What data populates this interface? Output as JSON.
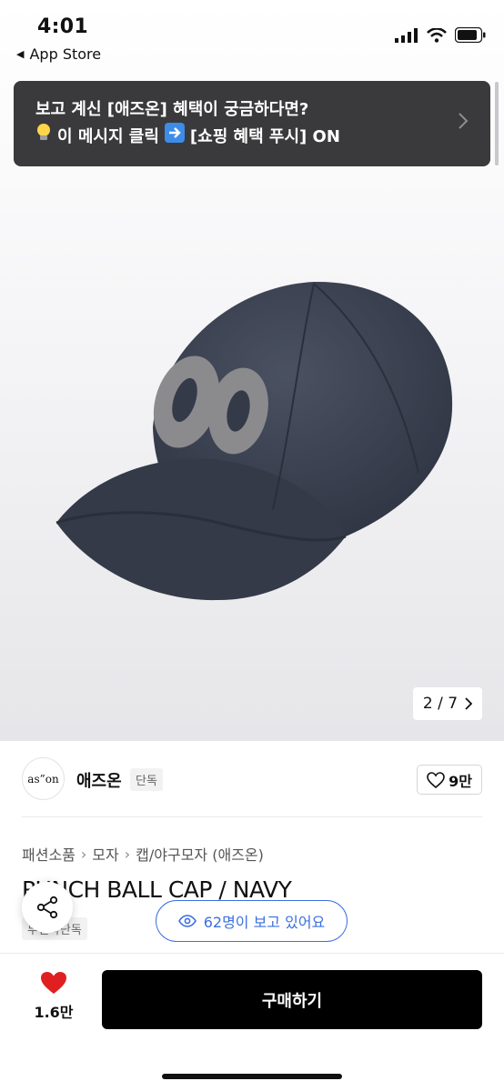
{
  "status_bar": {
    "time": "4:01",
    "back_app": "App Store"
  },
  "banner": {
    "line1": "보고 계신 [애즈온] 혜택이 궁금하다면?",
    "line2": "이 메시지 클릭",
    "line2_tail": "[쇼핑 혜택 푸시] ON",
    "icon1": "lightbulb-emoji",
    "icon2": "right-arrow-emoji"
  },
  "gallery": {
    "counter": "2 / 7"
  },
  "shop": {
    "logo_text": "as”on",
    "name": "애즈온",
    "badge": "단독",
    "like_count": "9만"
  },
  "breadcrumb": [
    "패션소품",
    "모자",
    "캡/야구모자 (애즈온)"
  ],
  "product": {
    "title": "PUNCH BALL CAP / NAVY",
    "badge": "무신사단독"
  },
  "viewers": {
    "label": "62명이 보고 있어요"
  },
  "bottom": {
    "wish_count": "1.6만",
    "buy_label": "구매하기"
  },
  "colors": {
    "cap": "#3a4150",
    "patch": "#8b8b8e",
    "accent_blue": "#3b6fe0",
    "heart": "#e02020",
    "banner_bg": "#3a3a3c"
  }
}
